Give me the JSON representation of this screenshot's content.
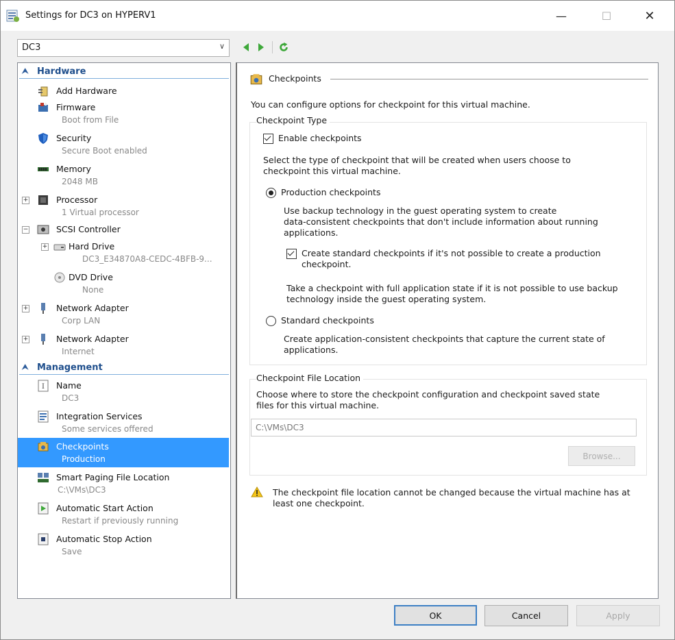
{
  "window": {
    "title": "Settings for DC3 on HYPERV1",
    "minimize": "—",
    "maximize": "☐",
    "close": "✕"
  },
  "vm_selector": {
    "value": "DC3",
    "chevron": "∨"
  },
  "nav": {
    "back_icon": "green-left-arrow",
    "forward_icon": "green-right-arrow",
    "refresh_icon": "green-refresh"
  },
  "tree": {
    "hardware_header": "Hardware",
    "management_header": "Management",
    "hardware_items": [
      {
        "name": "Add Hardware",
        "sub": ""
      },
      {
        "name": "Firmware",
        "sub": "Boot from File"
      },
      {
        "name": "Security",
        "sub": "Secure Boot enabled"
      },
      {
        "name": "Memory",
        "sub": "2048 MB"
      },
      {
        "name": "Processor",
        "sub": "1 Virtual processor"
      },
      {
        "name": "SCSI Controller",
        "sub": ""
      },
      {
        "name": "Hard Drive",
        "sub": "DC3_E34870A8-CEDC-4BFB-9..."
      },
      {
        "name": "DVD Drive",
        "sub": "None"
      },
      {
        "name": "Network Adapter",
        "sub": "Corp LAN"
      },
      {
        "name": "Network Adapter",
        "sub": "Internet"
      }
    ],
    "management_items": [
      {
        "name": "Name",
        "sub": "DC3"
      },
      {
        "name": "Integration Services",
        "sub": "Some services offered"
      },
      {
        "name": "Checkpoints",
        "sub": "Production"
      },
      {
        "name": "Smart Paging File Location",
        "sub": "C:\\VMs\\DC3"
      },
      {
        "name": "Automatic Start Action",
        "sub": "Restart if previously running"
      },
      {
        "name": "Automatic Stop Action",
        "sub": "Save"
      }
    ]
  },
  "checkpoints": {
    "header": "Checkpoints",
    "intro": "You can configure options for checkpoint for this virtual machine.",
    "type_group": "Checkpoint Type",
    "enable_label": "Enable checkpoints",
    "enable_checked": true,
    "select_type_line1": "Select the type of checkpoint that will be created when users choose to",
    "select_type_line2": "checkpoint this virtual machine.",
    "production_label": "Production checkpoints",
    "production_desc1": "Use backup technology in the guest operating system to create",
    "production_desc2": "data-consistent checkpoints that don't include information about running",
    "production_desc3": "applications.",
    "create_standard_line1": "Create standard checkpoints if it's not possible to create a production",
    "create_standard_line2": "checkpoint.",
    "create_standard_checked": true,
    "take_line1": "Take a checkpoint with full application state if it is not possible to use backup",
    "take_line2": "technology inside the guest operating system.",
    "standard_label": "Standard checkpoints",
    "standard_desc1": "Create application-consistent checkpoints that capture the current state of",
    "standard_desc2": "applications.",
    "selected_type": "Production checkpoints",
    "file_group": "Checkpoint File Location",
    "file_desc1": "Choose where to store the checkpoint configuration and checkpoint saved state",
    "file_desc2": "files for this virtual machine.",
    "file_path": "C:\\VMs\\DC3",
    "browse": "Browse...",
    "warning1": "The checkpoint file location cannot be changed because the virtual machine has at",
    "warning2": "least one checkpoint."
  },
  "buttons": {
    "ok": "OK",
    "cancel": "Cancel",
    "apply": "Apply"
  }
}
